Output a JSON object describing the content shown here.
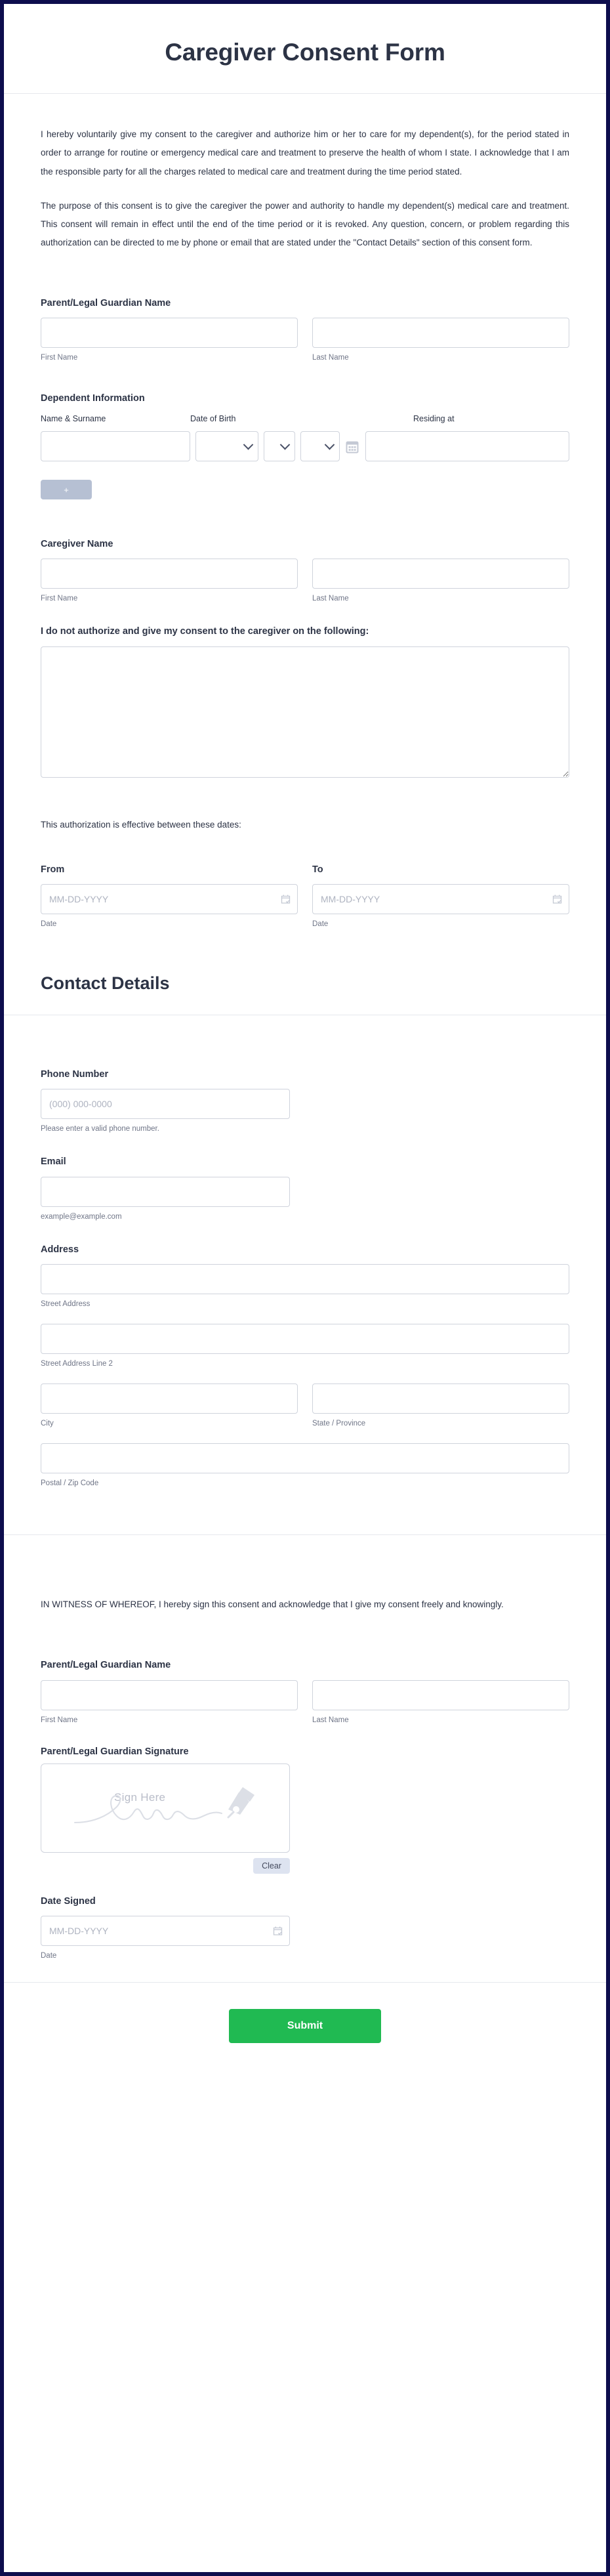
{
  "header": {
    "title": "Caregiver Consent Form"
  },
  "intro": {
    "paragraph_1": "I hereby voluntarily give my consent to the caregiver and authorize him or her to care for my dependent(s), for the period stated in order to arrange for routine or emergency medical care and treatment to preserve the health of whom I state. I acknowledge that I am the responsible party for all the charges related to medical care and treatment during the time period stated.",
    "paragraph_2": "The purpose of this consent is to give the caregiver the power and authority to handle my dependent(s) medical care and treatment. This consent will remain in effect until the end of the time period or it is revoked. Any question, concern, or problem regarding this authorization can be directed to me by phone or email that are stated under the \"Contact Details\" section of this consent form."
  },
  "guardian_name": {
    "label": "Parent/Legal Guardian Name",
    "first_sub": "First Name",
    "last_sub": "Last Name",
    "first_value": "",
    "last_value": ""
  },
  "dependent": {
    "label": "Dependent Information",
    "columns": [
      "Name & Surname",
      "Date of Birth",
      "Residing at"
    ],
    "row": {
      "name_value": "",
      "dob_month": "",
      "dob_day": "",
      "dob_year": "",
      "residing_value": ""
    },
    "add_button_label": "+",
    "calendar_icon": "calendar-icon"
  },
  "caregiver_name": {
    "label": "Caregiver Name",
    "first_sub": "First Name",
    "last_sub": "Last Name",
    "first_value": "",
    "last_value": ""
  },
  "not_authorize": {
    "label": "I do not authorize and give my consent to the caregiver on the following:",
    "value": "",
    "placeholder": ""
  },
  "effective_dates": {
    "intro": "This authorization is effective between these dates:",
    "from_label": "From",
    "to_label": "To",
    "from_placeholder": "MM-DD-YYYY",
    "to_placeholder": "MM-DD-YYYY",
    "from_value": "",
    "to_value": "",
    "from_sub": "Date",
    "to_sub": "Date"
  },
  "contact_details": {
    "title": "Contact Details",
    "phone": {
      "label": "Phone Number",
      "placeholder": "(000) 000-0000",
      "value": "",
      "hint": "Please enter a valid phone number."
    },
    "email": {
      "label": "Email",
      "placeholder": "",
      "value": "",
      "hint": "example@example.com"
    },
    "address": {
      "label": "Address",
      "street_sub": "Street Address",
      "street2_sub": "Street Address Line 2",
      "city_sub": "City",
      "state_sub": "State / Province",
      "postal_sub": "Postal / Zip Code",
      "street_value": "",
      "street2_value": "",
      "city_value": "",
      "state_value": "",
      "postal_value": ""
    }
  },
  "witness": {
    "statement": "IN WITNESS OF WHEREOF, I hereby sign this consent and acknowledge that I give my consent freely and knowingly.",
    "guardian_name_label": "Parent/Legal Guardian Name",
    "first_sub": "First Name",
    "last_sub": "Last Name",
    "first_value": "",
    "last_value": "",
    "signature_label": "Parent/Legal Guardian Signature",
    "signature_placeholder": "Sign Here",
    "clear_label": "Clear",
    "date_signed_label": "Date Signed",
    "date_signed_placeholder": "MM-DD-YYYY",
    "date_signed_value": "",
    "date_signed_sub": "Date"
  },
  "submit": {
    "label": "Submit"
  },
  "colors": {
    "page_border": "#0d0d4d",
    "text": "#2c3345",
    "muted": "#6f7587",
    "input_border": "#cfd3dc",
    "submit_green": "#20ba52",
    "add_button": "#b6c0d3",
    "clear_button": "#dde3f0"
  }
}
